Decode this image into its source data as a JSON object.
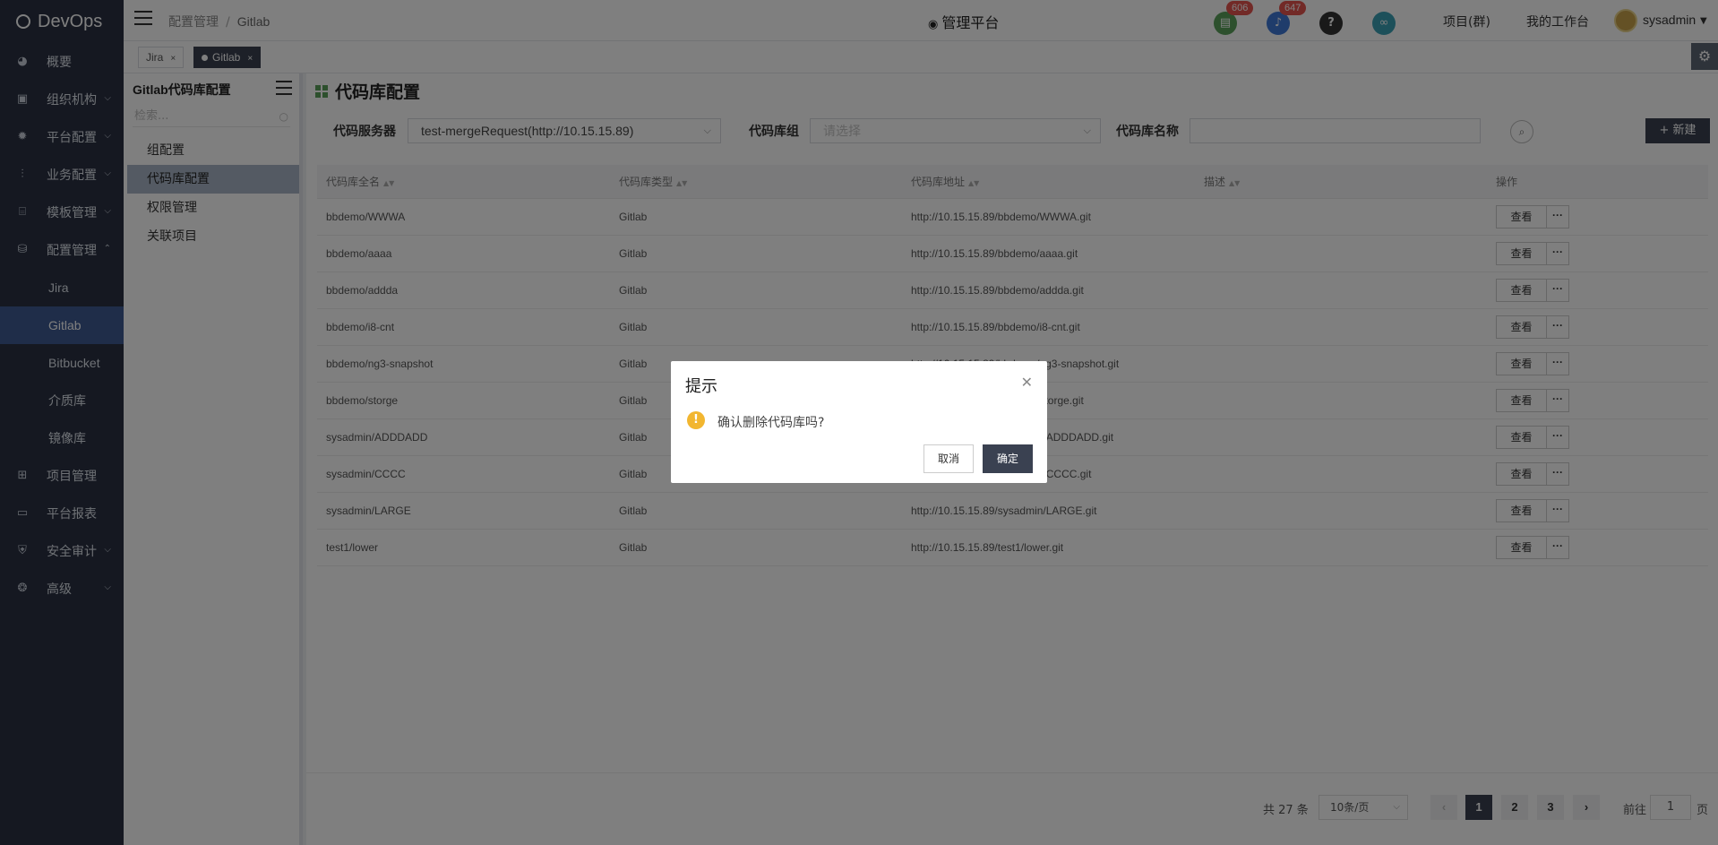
{
  "app": {
    "brand": "DevOps"
  },
  "sidebar": {
    "items": [
      {
        "label": "概要",
        "icon": "dashboard-icon",
        "glyph": "◕",
        "chevron": ""
      },
      {
        "label": "组织机构",
        "icon": "lock-icon",
        "glyph": "▣",
        "chevron": "⌵"
      },
      {
        "label": "平台配置",
        "icon": "gear-icon",
        "glyph": "✹",
        "chevron": "⌵"
      },
      {
        "label": "业务配置",
        "icon": "sliders-icon",
        "glyph": "⫶",
        "chevron": "⌵"
      },
      {
        "label": "模板管理",
        "icon": "template-icon",
        "glyph": "⌸",
        "chevron": "⌵"
      },
      {
        "label": "配置管理",
        "icon": "database-icon",
        "glyph": "⛁",
        "chevron": "⌃"
      }
    ],
    "sub_items": [
      {
        "label": "Jira",
        "active": false
      },
      {
        "label": "Gitlab",
        "active": true
      },
      {
        "label": "Bitbucket",
        "active": false
      },
      {
        "label": "介质库",
        "active": false
      },
      {
        "label": "镜像库",
        "active": false
      }
    ],
    "bottom_items": [
      {
        "label": "项目管理",
        "icon": "grid-icon",
        "glyph": "⊞",
        "chevron": ""
      },
      {
        "label": "平台报表",
        "icon": "monitor-icon",
        "glyph": "▭",
        "chevron": ""
      },
      {
        "label": "安全审计",
        "icon": "shield-icon",
        "glyph": "⛨",
        "chevron": "⌵"
      },
      {
        "label": "高级",
        "icon": "brain-icon",
        "glyph": "❂",
        "chevron": "⌵"
      }
    ]
  },
  "header": {
    "breadcrumb": [
      "配置管理",
      "Gitlab"
    ],
    "platform_title": "管理平台",
    "badges": {
      "tasks": "606",
      "notifications": "647"
    },
    "links": {
      "projects": "项目(群)",
      "workbench": "我的工作台"
    },
    "user": "sysadmin"
  },
  "tabs": [
    {
      "label": "Jira",
      "active": false
    },
    {
      "label": "Gitlab",
      "active": true
    }
  ],
  "submenu": {
    "title": "Gitlab代码库配置",
    "search_placeholder": "检索...",
    "items": [
      {
        "label": "组配置",
        "active": false
      },
      {
        "label": "代码库配置",
        "active": true
      },
      {
        "label": "权限管理",
        "active": false
      },
      {
        "label": "关联项目",
        "active": false
      }
    ]
  },
  "main": {
    "title": "代码库配置",
    "filters": {
      "server_label": "代码服务器",
      "server_value": "test-mergeRequest(http://10.15.15.89)",
      "group_label": "代码库组",
      "group_placeholder": "请选择",
      "name_label": "代码库名称",
      "name_value": ""
    },
    "new_button": "+ 新建",
    "table": {
      "headers": [
        "代码库全名",
        "代码库类型",
        "代码库地址",
        "描述",
        "操作"
      ],
      "rows": [
        {
          "name": "bbdemo/WWWA",
          "type": "Gitlab",
          "url": "http://10.15.15.89/bbdemo/WWWA.git",
          "desc": ""
        },
        {
          "name": "bbdemo/aaaa",
          "type": "Gitlab",
          "url": "http://10.15.15.89/bbdemo/aaaa.git",
          "desc": ""
        },
        {
          "name": "bbdemo/addda",
          "type": "Gitlab",
          "url": "http://10.15.15.89/bbdemo/addda.git",
          "desc": ""
        },
        {
          "name": "bbdemo/i8-cnt",
          "type": "Gitlab",
          "url": "http://10.15.15.89/bbdemo/i8-cnt.git",
          "desc": ""
        },
        {
          "name": "bbdemo/ng3-snapshot",
          "type": "Gitlab",
          "url": "http://10.15.15.89/bbdemo/ng3-snapshot.git",
          "desc": ""
        },
        {
          "name": "bbdemo/storge",
          "type": "Gitlab",
          "url": "http://10.15.15.89/bbdemo/storge.git",
          "desc": ""
        },
        {
          "name": "sysadmin/ADDDADD",
          "type": "Gitlab",
          "url": "http://10.15.15.89/sysadmin/ADDDADD.git",
          "desc": ""
        },
        {
          "name": "sysadmin/CCCC",
          "type": "Gitlab",
          "url": "http://10.15.15.89/sysadmin/CCCC.git",
          "desc": ""
        },
        {
          "name": "sysadmin/LARGE",
          "type": "Gitlab",
          "url": "http://10.15.15.89/sysadmin/LARGE.git",
          "desc": ""
        },
        {
          "name": "test1/lower",
          "type": "Gitlab",
          "url": "http://10.15.15.89/test1/lower.git",
          "desc": ""
        }
      ],
      "view_label": "查看",
      "more_label": "···"
    },
    "pagination": {
      "total": "共 27 条",
      "page_size": "10条/页",
      "pages": [
        "1",
        "2",
        "3"
      ],
      "current": "1",
      "goto_label": "前往",
      "goto_value": "1",
      "goto_unit": "页"
    }
  },
  "modal": {
    "title": "提示",
    "message": "确认删除代码库吗?",
    "cancel": "取消",
    "ok": "确定"
  },
  "colors": {
    "sidebar_bg": "#2a3142",
    "active_nav": "#3f5b93",
    "primary_btn": "#3a4151",
    "warning": "#f2b630",
    "badge": "#e5554f"
  }
}
